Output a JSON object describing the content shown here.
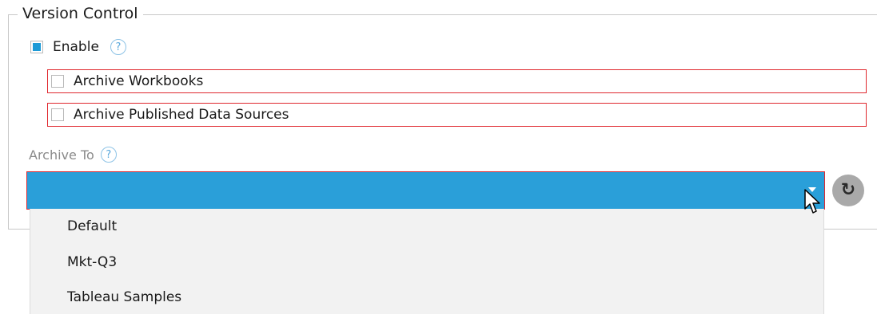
{
  "version_control": {
    "title": "Version Control",
    "enable": {
      "label": "Enable",
      "checked": true,
      "help": "?"
    },
    "archive_workbooks": {
      "label": "Archive Workbooks",
      "checked": false
    },
    "archive_data_sources": {
      "label": "Archive Published Data Sources",
      "checked": false
    },
    "archive_to": {
      "label": "Archive To",
      "help": "?",
      "selected_value": "",
      "options": [
        "Default",
        "Mkt-Q3",
        "Tableau Samples"
      ]
    },
    "refresh_glyph": "↻"
  },
  "colors": {
    "accent_blue": "#2a9fd9",
    "error_red": "#e0282e",
    "dropdown_bg": "#f2f2f2"
  },
  "icons": [
    "help-icon",
    "refresh-icon",
    "dropdown-arrow-icon",
    "mouse-cursor-icon"
  ]
}
